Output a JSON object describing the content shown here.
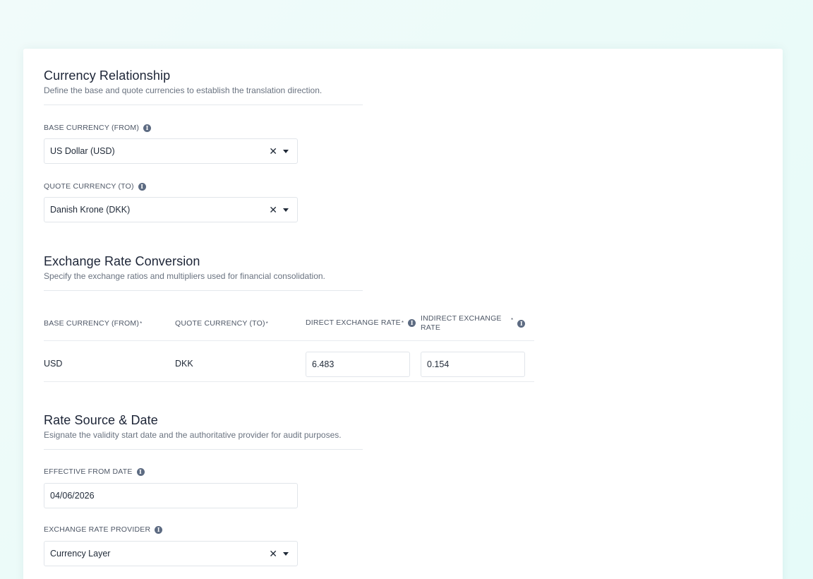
{
  "sections": {
    "currency": {
      "title": "Currency Relationship",
      "description": "Define the base and quote currencies to establish the translation direction.",
      "base_label": "BASE CURRENCY (FROM)",
      "base_value": "US Dollar (USD)",
      "quote_label": "QUOTE CURRENCY (TO)",
      "quote_value": "Danish Krone (DKK)"
    },
    "conversion": {
      "title": "Exchange Rate Conversion",
      "description": "Specify the exchange ratios and multipliers used for financial consolidation.",
      "columns": [
        "BASE CURRENCY (FROM)",
        "QUOTE CURRENCY (TO)",
        "DIRECT EXCHANGE RATE",
        "INDIRECT EXCHANGE RATE"
      ],
      "row": {
        "base": "USD",
        "quote": "DKK",
        "direct_rate": "6.483",
        "indirect_rate": "0.154"
      }
    },
    "source": {
      "title": "Rate Source & Date",
      "description": "Esignate the validity start date and the authoritative provider for audit purposes.",
      "date_label": "EFFECTIVE FROM DATE",
      "date_value": "04/06/2026",
      "provider_label": "EXCHANGE RATE PROVIDER",
      "provider_value": "Currency Layer"
    }
  },
  "icons": {
    "info": "info-icon",
    "clear": "close-icon",
    "caret": "chevron-down-icon"
  },
  "glyphs": {
    "info": "i",
    "clear": "✕",
    "required": "*"
  }
}
